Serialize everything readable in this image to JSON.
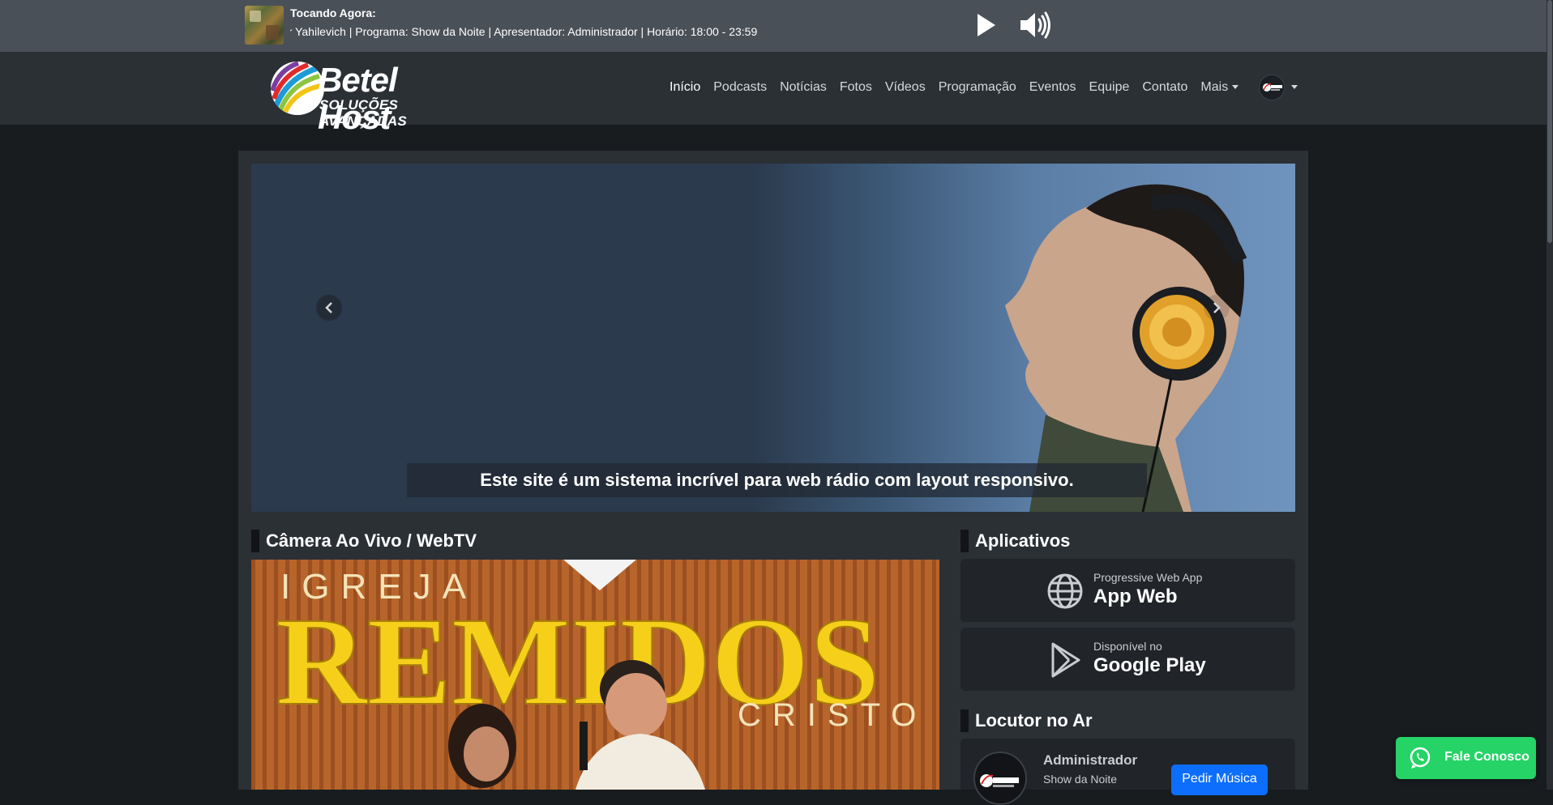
{
  "player": {
    "now_playing_label": "Tocando Agora:",
    "track_info": "or Yahilevich | Programa: Show da Noite | Apresentador: Administrador | Horário: 18:00 - 23:59"
  },
  "brand": {
    "name": "Betel Host",
    "tagline": "SOLUÇÕES AVANÇADAS"
  },
  "nav": {
    "items": [
      {
        "label": "Início"
      },
      {
        "label": "Podcasts"
      },
      {
        "label": "Notícias"
      },
      {
        "label": "Fotos"
      },
      {
        "label": "Vídeos"
      },
      {
        "label": "Programação"
      },
      {
        "label": "Eventos"
      },
      {
        "label": "Equipe"
      },
      {
        "label": "Contato"
      },
      {
        "label": "Mais"
      }
    ]
  },
  "hero": {
    "caption": "Este site é um sistema incrível para web rádio com layout responsivo."
  },
  "webtv": {
    "title": "Câmera Ao Vivo / WebTV",
    "video_text_top": "IGREJA",
    "video_text_main": "REMIDOS",
    "video_text_bottom": "CRISTO"
  },
  "apps": {
    "title": "Aplicativos",
    "items": [
      {
        "small": "Progressive Web App",
        "big": "App Web",
        "icon": "globe-icon"
      },
      {
        "small": "Disponível no",
        "big": "Google Play",
        "icon": "google-play-icon"
      }
    ]
  },
  "dj": {
    "title": "Locutor no Ar",
    "name": "Administrador",
    "show": "Show da Noite",
    "request_button": "Pedir Música"
  },
  "whatsapp": {
    "label": "Fale Conosco"
  },
  "colors": {
    "page_bg": "#181c1f",
    "navbar_bg": "#2b3035",
    "player_bg": "#4a5058",
    "primary": "#0d6efd",
    "whatsapp": "#25d366"
  }
}
